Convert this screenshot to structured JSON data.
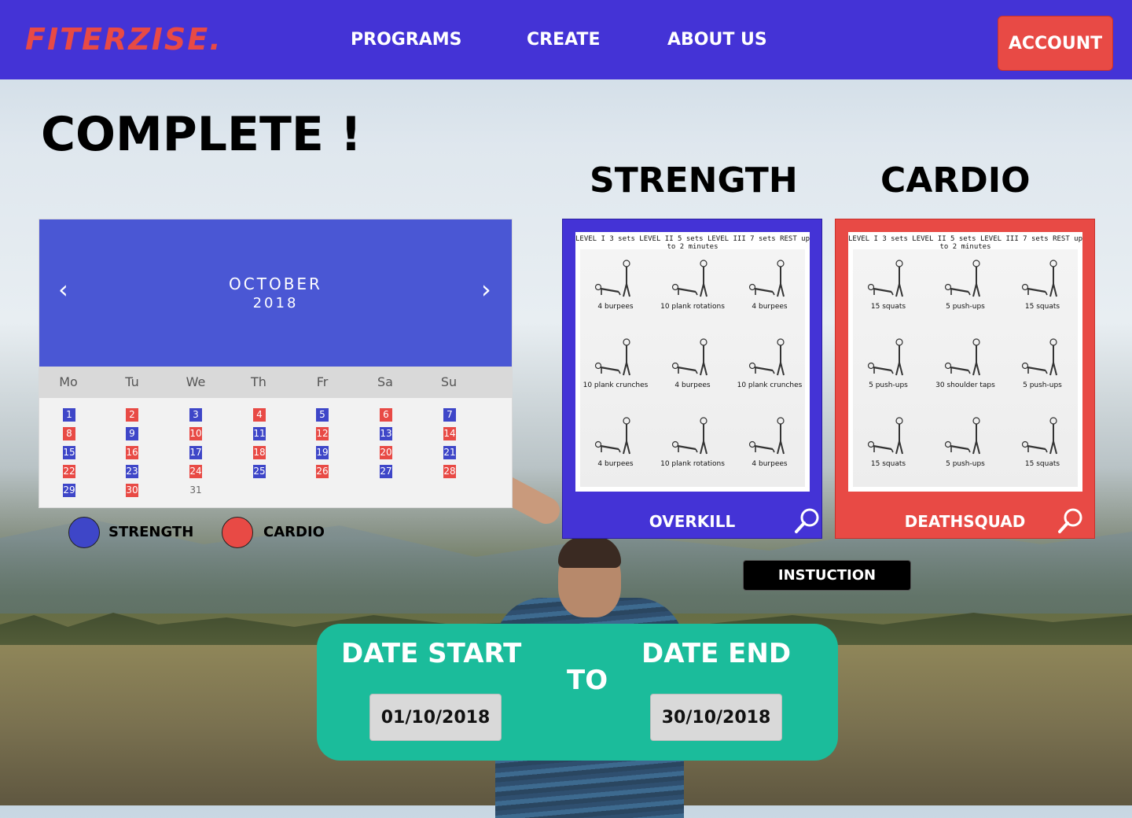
{
  "brand": {
    "logo": "FITERZISE."
  },
  "nav": {
    "programs": "PROGRAMS",
    "create": "CREATE",
    "about": "ABOUT US",
    "account": "ACCOUNT"
  },
  "page": {
    "title": "COMPLETE !"
  },
  "sections": {
    "strength": "STRENGTH",
    "cardio": "CARDIO"
  },
  "calendar": {
    "month": "OCTOBER",
    "year": "2018",
    "prev_icon": "‹",
    "next_icon": "›",
    "weekdays": [
      "Mo",
      "Tu",
      "We",
      "Th",
      "Fr",
      "Sa",
      "Su"
    ],
    "days": [
      {
        "n": "1",
        "t": "strength"
      },
      {
        "n": "2",
        "t": "cardio"
      },
      {
        "n": "3",
        "t": "strength"
      },
      {
        "n": "4",
        "t": "cardio"
      },
      {
        "n": "5",
        "t": "strength"
      },
      {
        "n": "6",
        "t": "cardio"
      },
      {
        "n": "7",
        "t": "strength"
      },
      {
        "n": "8",
        "t": "cardio"
      },
      {
        "n": "9",
        "t": "strength"
      },
      {
        "n": "10",
        "t": "cardio"
      },
      {
        "n": "11",
        "t": "strength"
      },
      {
        "n": "12",
        "t": "cardio"
      },
      {
        "n": "13",
        "t": "strength"
      },
      {
        "n": "14",
        "t": "cardio"
      },
      {
        "n": "15",
        "t": "strength"
      },
      {
        "n": "16",
        "t": "cardio"
      },
      {
        "n": "17",
        "t": "strength"
      },
      {
        "n": "18",
        "t": "cardio"
      },
      {
        "n": "19",
        "t": "strength"
      },
      {
        "n": "20",
        "t": "cardio"
      },
      {
        "n": "21",
        "t": "strength"
      },
      {
        "n": "22",
        "t": "cardio"
      },
      {
        "n": "23",
        "t": "strength"
      },
      {
        "n": "24",
        "t": "cardio"
      },
      {
        "n": "25",
        "t": "strength"
      },
      {
        "n": "26",
        "t": "cardio"
      },
      {
        "n": "27",
        "t": "strength"
      },
      {
        "n": "28",
        "t": "cardio"
      },
      {
        "n": "29",
        "t": "strength"
      },
      {
        "n": "30",
        "t": "cardio"
      },
      {
        "n": "31",
        "t": "none"
      }
    ]
  },
  "legend": {
    "strength": "STRENGTH",
    "cardio": "CARDIO"
  },
  "colors": {
    "brand_blue": "#4433d6",
    "calendar_blue": "#4a57d4",
    "strength": "#3e46c8",
    "cardio": "#e84a45",
    "teal": "#1bbc9b"
  },
  "programs": {
    "strength": {
      "name": "OVERKILL",
      "levels": "LEVEL I 3 sets LEVEL II 5 sets LEVEL III 7 sets REST up to 2 minutes",
      "exercises": [
        "4 burpees",
        "10 plank rotations",
        "4 burpees",
        "10 plank crunches",
        "4 burpees",
        "10 plank crunches",
        "4 burpees",
        "10 plank rotations",
        "4 burpees"
      ]
    },
    "cardio": {
      "name": "DEATHSQUAD",
      "levels": "LEVEL I 3 sets LEVEL II 5 sets LEVEL III 7 sets REST up to 2 minutes",
      "exercises": [
        "15 squats",
        "5 push-ups",
        "15 squats",
        "5 push-ups",
        "30 shoulder taps",
        "5 push-ups",
        "15 squats",
        "5 push-ups",
        "15 squats"
      ]
    },
    "zoom_icon": "search-icon"
  },
  "instruction": {
    "label": "INSTUCTION"
  },
  "dates": {
    "start_label": "DATE START",
    "to_label": "TO",
    "end_label": "DATE END",
    "start_value": "01/10/2018",
    "end_value": "30/10/2018"
  }
}
